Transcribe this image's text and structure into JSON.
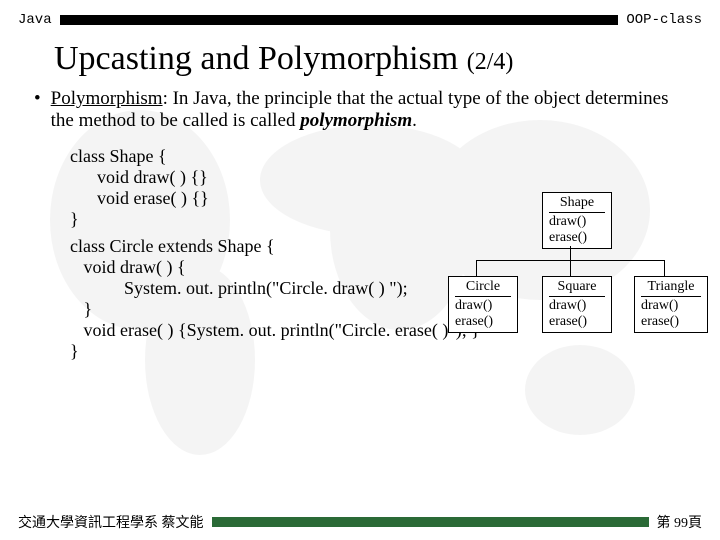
{
  "header": {
    "left": "Java",
    "right": "OOP-class"
  },
  "title": {
    "main": "Upcasting and Polymorphism",
    "pager": "(2/4)"
  },
  "bullet": {
    "lead": "Polymorphism",
    "rest": ": In Java, the principle that the actual type of the object determines the method to be called is called ",
    "em": "polymorphism",
    "tail": "."
  },
  "code": {
    "l1": "class Shape {",
    "l2": "      void draw( ) {}",
    "l3": "      void erase( ) {}",
    "l4": "}",
    "l5": "class Circle extends Shape {",
    "l6": "   void draw( ) {",
    "l7": "            System. out. println(\"Circle. draw( ) \");",
    "l8": "   }",
    "l9": "   void erase( ) {System. out. println(\"Circle. erase( )\"); }",
    "l10": "}"
  },
  "diagram": {
    "shape": {
      "name": "Shape",
      "m1": "draw()",
      "m2": "erase()"
    },
    "circle": {
      "name": "Circle",
      "m1": "draw()",
      "m2": "erase()"
    },
    "square": {
      "name": "Square",
      "m1": "draw()",
      "m2": "erase()"
    },
    "triangle": {
      "name": "Triangle",
      "m1": "draw()",
      "m2": "erase()"
    }
  },
  "footer": {
    "left": "交通大學資訊工程學系 蔡文能",
    "right": "第 99頁"
  }
}
